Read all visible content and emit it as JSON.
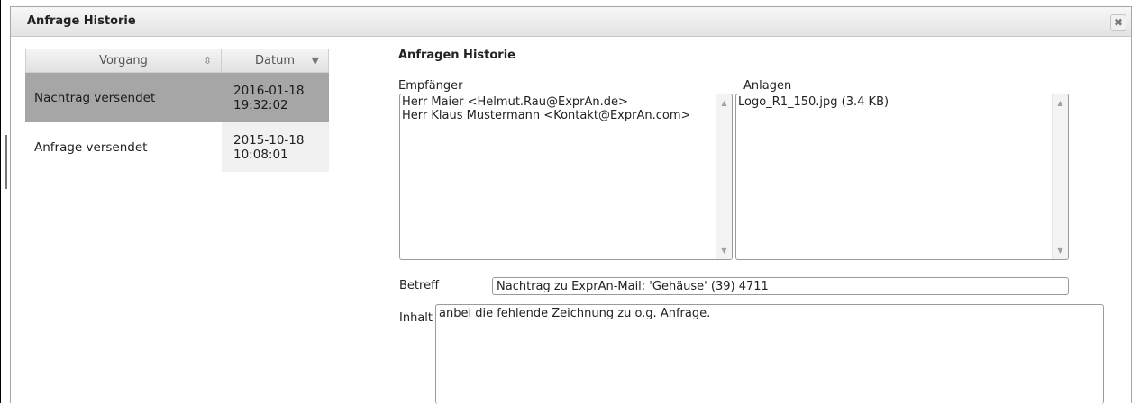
{
  "dialog": {
    "title": "Anfrage Historie",
    "close_icon": "close-icon"
  },
  "grid": {
    "columns": [
      "Vorgang",
      "Datum"
    ],
    "sort_icons": [
      "⇳",
      "▼"
    ],
    "rows": [
      {
        "vorgang": "Nachtrag versendet",
        "datum_date": "2016-01-18",
        "datum_time": "19:32:02",
        "selected": true
      },
      {
        "vorgang": "Anfrage versendet",
        "datum_date": "2015-10-18",
        "datum_time": "10:08:01",
        "selected": false
      }
    ]
  },
  "detail": {
    "section_title": "Anfragen Historie",
    "empfaenger_label": "Empfänger",
    "empfaenger_lines": [
      "Herr Maier <Helmut.Rau@ExprAn.de>",
      "Herr Klaus Mustermann <Kontakt@ExprAn.com>"
    ],
    "anlagen_label": "Anlagen",
    "anlagen_lines": [
      "Logo_R1_150.jpg (3.4 KB)"
    ],
    "betreff_label": "Betreff",
    "betreff_value": "Nachtrag zu ExprAn-Mail: 'Gehäuse' (39)  4711",
    "inhalt_label": "Inhalt",
    "inhalt_value": "anbei die fehlende Zeichnung zu o.g. Anfrage."
  },
  "colors": {
    "selected_row": "#a6a6a6",
    "titlebar": "#e9e9e9",
    "border": "#9a9a9a"
  }
}
